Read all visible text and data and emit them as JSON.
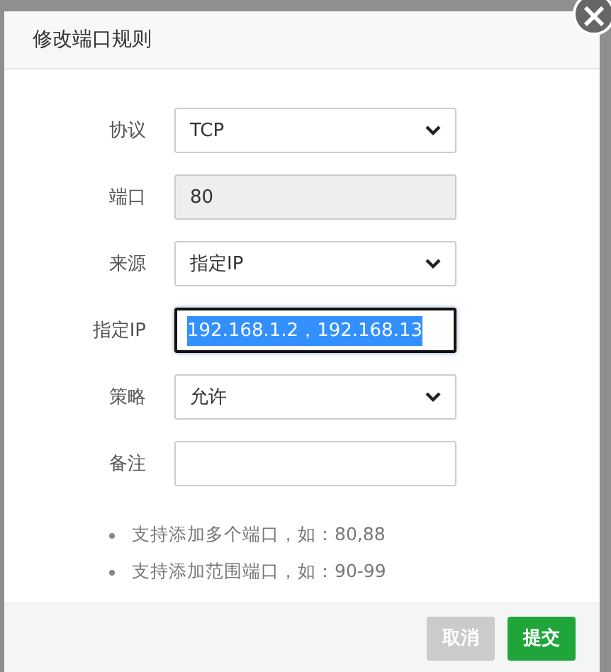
{
  "dialog": {
    "title": "修改端口规则",
    "close_icon": "×",
    "fields": [
      {
        "label": "协议",
        "kind": "select",
        "value": "TCP",
        "focused": false
      },
      {
        "label": "端口",
        "kind": "readonly",
        "value": "80",
        "focused": false
      },
      {
        "label": "来源",
        "kind": "select",
        "value": "指定IP",
        "focused": false
      },
      {
        "label": "指定IP",
        "kind": "input",
        "value": "192.168.1.2，192.168.13",
        "focused": true,
        "text_selected": true
      },
      {
        "label": "策略",
        "kind": "select",
        "value": "允许",
        "focused": false
      },
      {
        "label": "备注",
        "kind": "input",
        "focused": false
      }
    ],
    "tips": [
      "支持添加多个端口，如：80,88",
      "支持添加范围端口，如：90-99"
    ],
    "buttons": [
      {
        "label": "取消",
        "kind": "secondary"
      },
      {
        "label": "提交",
        "kind": "primary"
      }
    ]
  }
}
